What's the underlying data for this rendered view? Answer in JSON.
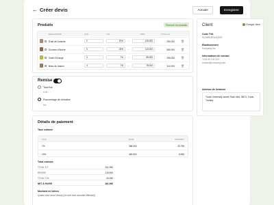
{
  "header": {
    "title": "Créer devis",
    "cancel_label": "Annuler",
    "save_label": "Enregistrer"
  },
  "produits": {
    "title": "Produits",
    "browse_label": "Parcourir les produits",
    "columns": [
      "DÉSIGNATION",
      "QTÉ",
      "TVA",
      "PRIX",
      "TOTAL HT"
    ],
    "rows": [
      {
        "name": "Éclat de Lavande",
        "qty": "2",
        "tva": "19%",
        "price": "125.000",
        "total": "250.000",
        "thumb_color": "#b58a6a"
      },
      {
        "name": "Douceur d'Ambre",
        "qty": "5",
        "tva": "19%",
        "price": "110.000",
        "total": "550.000",
        "thumb_color": "#8a6a55"
      },
      {
        "name": "Soleil d'Orange",
        "qty": "3",
        "tva": "7%",
        "price": "85.000",
        "total": "255.000",
        "thumb_color": "#c9b04a"
      },
      {
        "name": "Brise de Jasmin",
        "qty": "4",
        "tva": "7%",
        "price": "78.000",
        "total": "312.000",
        "thumb_color": "#9a7a62"
      }
    ]
  },
  "client": {
    "title": "Client",
    "change_label": "Changer client",
    "tva_label": "Code TVA",
    "tva_value": "0123591BTA4QZ2E",
    "company_label": "Établissement",
    "company_value": "Company Inc.",
    "contact_label": "Informations de contact",
    "phone": "+216 20 132 224",
    "email": "contact@company.com",
    "address_label": "Adresse de livraison",
    "address": "Tunis University street, Bab Jdid, 5874, Tunis, Tunisia"
  },
  "remise": {
    "title": "Remise",
    "toggle_on": true,
    "fixed_label": "Taux fixe",
    "fixed_value": "0.00",
    "percent_label": "Pourcentage de réduction",
    "percent_value": "5%"
  },
  "paiement": {
    "title": "Détails de paiement",
    "tax_label": "Taxe estimée",
    "tax_columns": [
      "TAUX",
      "BASE",
      "MONTANT"
    ],
    "tax_rows": [
      {
        "rate": "7%",
        "base": "368.500",
        "amount": "25.795"
      },
      {
        "rate": "19%",
        "base": "469.500",
        "amount": "8.555"
      }
    ],
    "total_label": "Total estimée",
    "totals": [
      {
        "label": "TOTAL H.T",
        "value": "331.950"
      },
      {
        "label": "REMISE",
        "value": "119.690"
      },
      {
        "label": "TOTAL TVA",
        "value": "40.050"
      },
      {
        "label": "NET À PAYER",
        "value": "461.960"
      }
    ],
    "words_label": "Montant en lettres",
    "words_value": "Quatre cent deux Dinar(s) et neuf cent soixante  Millime(s)"
  }
}
